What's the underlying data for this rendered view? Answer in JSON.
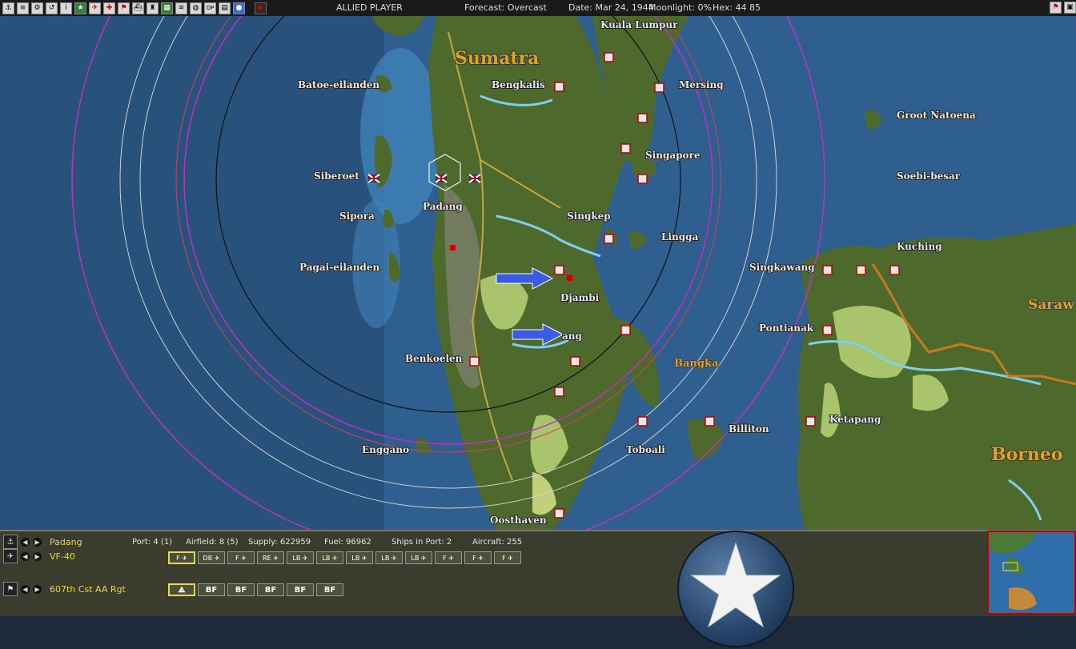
{
  "topbar": {
    "side": "ALLIED PLAYER",
    "forecast": "Forecast: Overcast",
    "date": "Date: Mar 24, 1944",
    "moonlight": "Moonlight: 0%",
    "hex": "Hex: 44 85",
    "buttons": [
      "anchor-icon",
      "list-icon",
      "gear-icon",
      "return-icon",
      "info-icon",
      "star-icon",
      "plane-icon",
      "cross-icon",
      "flag-icon",
      "ship-icon",
      "unit-icon",
      "map-icon",
      "ships-icon",
      "globe-icon",
      "op-icon",
      "report-icon",
      "save-icon"
    ],
    "play_icon": "play-icon"
  },
  "map": {
    "regions": {
      "sumatra": "Sumatra",
      "borneo": "Borneo",
      "sarawak": "Saraw"
    },
    "places": [
      "Kuala Lumpur",
      "Batoe-eilanden",
      "Bengkalis",
      "Mersing",
      "Groot Natoena",
      "Singapore",
      "Siberoet",
      "Soebi-besar",
      "Padang",
      "Singkep",
      "Sipora",
      "Lingga",
      "Kuching",
      "Pagai-eilanden",
      "Singkawang",
      "Djambi",
      "Pontianak",
      "Bangka",
      "Benkoelen",
      "Billiton",
      "Ketapang",
      "Toboali",
      "Enggano",
      "Oosthaven",
      "ang"
    ]
  },
  "panel": {
    "base_name": "Padang",
    "squadron": "VF-40",
    "unit": "607th Cst AA Rgt",
    "port": "Port: 4 (1)",
    "airfield": "Airfield: 8 (5)",
    "supply": "Supply: 622959",
    "fuel": "Fuel: 96962",
    "ships": "Ships in Port: 2",
    "aircraft": "Aircraft: 255",
    "air_units": [
      "F",
      "DB",
      "F",
      "RE",
      "LB",
      "LB",
      "LB",
      "LB",
      "LB",
      "F",
      "F",
      "F"
    ],
    "ground_units": [
      "",
      "BF",
      "BF",
      "BF",
      "BF",
      "BF"
    ]
  },
  "colors": {
    "ocean": "#2d5d8c",
    "land": "#4f6a2a",
    "japanese_base": "#d42020",
    "range_magenta": "#c030c0",
    "range_white": "#d0d0d0",
    "label_orange": "#e0a12a"
  }
}
